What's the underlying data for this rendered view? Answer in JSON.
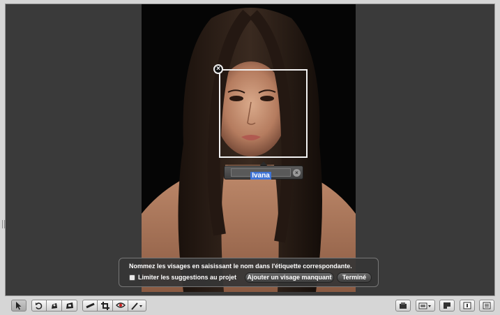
{
  "faces": {
    "detected_name": "Ivana",
    "remove_face_icon": "close-circle-icon",
    "clear_name_icon": "clear-field-icon"
  },
  "hud": {
    "message": "Nommez les visages en saisissant le nom dans l'étiquette correspondante.",
    "limit_checkbox_label": "Limiter les suggestions au projet",
    "limit_checked": false,
    "add_missing_face_label": "Ajouter un visage manquant",
    "done_label": "Terminé"
  },
  "toolbar": {
    "left_tools": [
      "select-arrow-icon",
      "rotate-left-icon",
      "lift-stamp-icon",
      "stamp-icon",
      "straighten-icon",
      "crop-icon",
      "red-eye-icon",
      "brush-menu-icon"
    ],
    "right_tools": [
      "import-icon",
      "view-options-menu-icon",
      "bookmark-icon",
      "single-view-icon",
      "browser-view-icon"
    ]
  },
  "colors": {
    "viewer_background": "#3a3a3a",
    "window_chrome": "#d6d6d6",
    "selection_highlight": "#3f74d6"
  }
}
